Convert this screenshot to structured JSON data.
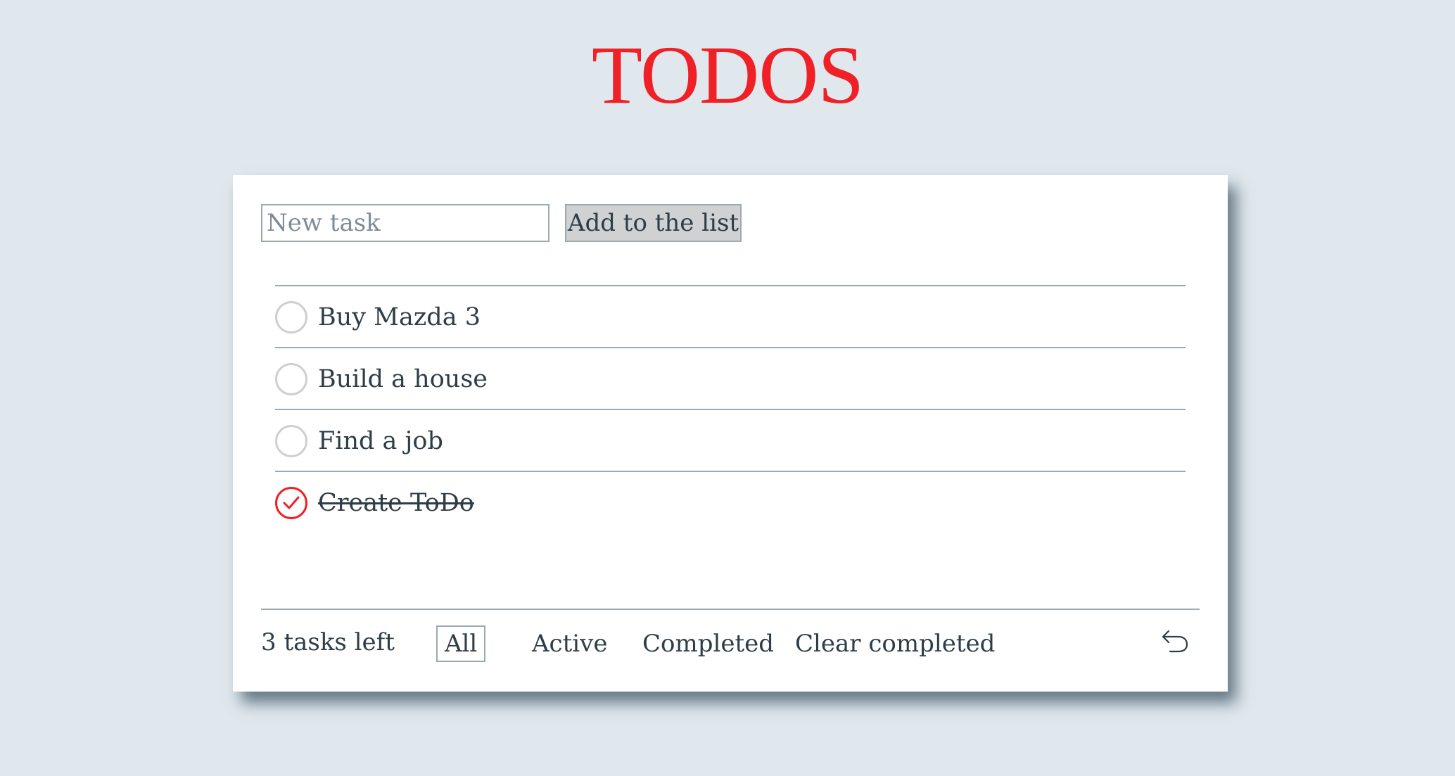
{
  "header": {
    "title": "TODOS"
  },
  "new_task": {
    "placeholder": "New task",
    "value": "",
    "add_label": "Add to the list"
  },
  "todos": [
    {
      "text": "Buy Mazda 3",
      "completed": false
    },
    {
      "text": "Build a house",
      "completed": false
    },
    {
      "text": "Find a job",
      "completed": false
    },
    {
      "text": "Create ToDo",
      "completed": true
    }
  ],
  "footer": {
    "tasks_left": "3 tasks left",
    "filters": {
      "all": "All",
      "active": "Active",
      "completed": "Completed"
    },
    "selected_filter": "All",
    "clear_completed": "Clear completed",
    "undo_icon": "undo-arrow-icon"
  },
  "colors": {
    "accent": "#ef2026",
    "background": "#e0e7ed",
    "text": "#2e3d47",
    "border": "#9aaab3"
  }
}
